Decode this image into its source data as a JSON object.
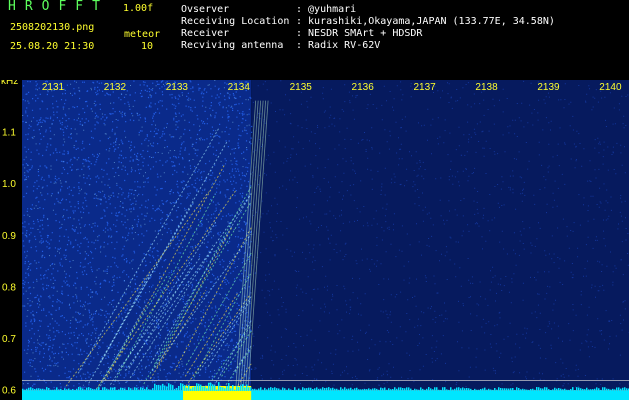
{
  "header": {
    "app_title": "HROFFT",
    "app_version": "1.00f",
    "file_name": "2508202130.png",
    "timestamp": "25.08.20 21:30",
    "mode_label": "meteor",
    "mode_value": "10",
    "info_labels": [
      "Ovserver",
      "Receiving Location",
      "Receiver",
      "Recviving antenna"
    ],
    "info_values": [
      ": @yuhmari",
      ": kurashiki,Okayama,JAPAN (133.77E, 34.58N)",
      ": NESDR SMArt + HDSDR",
      ": Radix RV-62V"
    ]
  },
  "colors": {
    "background": "#000000",
    "text_green": "#5dff5d",
    "text_yellow": "#ffff2e",
    "text_white": "#ffffff",
    "spectrum_deep": "#061a5e",
    "spectrum_noise": "#2a6cff",
    "trace_green": "#7dffb0",
    "meteor_yellow": "#ffff00",
    "baseline_cyan": "#00e6ff"
  },
  "chart_data": {
    "type": "heatmap",
    "ylabel": "kHz",
    "x_ticks": [
      "2131",
      "2132",
      "2133",
      "2134",
      "2135",
      "2136",
      "2137",
      "2138",
      "2139",
      "2140"
    ],
    "y_ticks": [
      "0.6",
      "0.7",
      "0.8",
      "0.9",
      "1.0",
      "1.1"
    ],
    "ylim": [
      0.58,
      1.2
    ],
    "xlim_minutes": [
      2130.5,
      2140.3
    ],
    "marker_lines_khz": [
      0.598,
      0.618
    ],
    "meteor_band_minutes": [
      2133.1,
      2134.2
    ],
    "dark_region_start_minute": 2134.2
  }
}
